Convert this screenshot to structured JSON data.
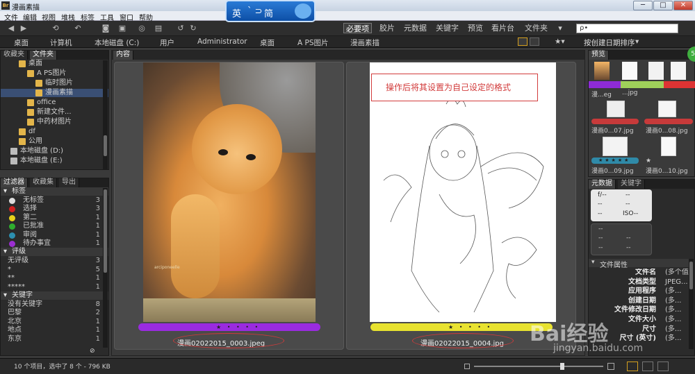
{
  "window": {
    "title": "漫画素描",
    "logo": "Br",
    "min": "─",
    "max": "□",
    "close": "✕"
  },
  "ime": {
    "label_a": "英",
    "label_b": "ˋ ⊃",
    "label_c": "简"
  },
  "menu": [
    "文件",
    "编辑",
    "视图",
    "堆栈",
    "标签",
    "工具",
    "窗口",
    "帮助"
  ],
  "workspaces": [
    "必要项",
    "胶片",
    "元数据",
    "关键字",
    "预览",
    "看片台",
    "文件夹"
  ],
  "search": {
    "placeholder": "ρ•"
  },
  "sort": {
    "label": "按创建日期排序"
  },
  "path": [
    "桌面",
    "计算机",
    "本地磁盘 (C:)",
    "用户",
    "Administrator",
    "桌面",
    "A PS图片",
    "漫画素描"
  ],
  "left_top": {
    "tabs": [
      "收藏夹",
      "文件夹"
    ],
    "items": [
      {
        "label": "桌面",
        "indent": 1
      },
      {
        "label": "A PS图片",
        "indent": 2
      },
      {
        "label": "临时图片",
        "indent": 3
      },
      {
        "label": "漫画素描",
        "indent": 3,
        "selected": true
      },
      {
        "label": "office",
        "indent": 2
      },
      {
        "label": "新建文件...",
        "indent": 2
      },
      {
        "label": "中药材图片",
        "indent": 2
      },
      {
        "label": "df",
        "indent": 1
      },
      {
        "label": "公用",
        "indent": 1
      },
      {
        "label": "本地磁盘 (D:)",
        "indent": 0
      },
      {
        "label": "本地磁盘 (E:)",
        "indent": 0
      }
    ]
  },
  "filter": {
    "tabs": [
      "过滤器",
      "收藏集",
      "导出"
    ],
    "labels_header": "标签",
    "labels": [
      {
        "name": "无标签",
        "count": "3",
        "color": "#dddddd"
      },
      {
        "name": "选择",
        "count": "3",
        "color": "#d22020"
      },
      {
        "name": "第二",
        "count": "1",
        "color": "#e8d21a"
      },
      {
        "name": "已批准",
        "count": "1",
        "color": "#2fae2f"
      },
      {
        "name": "审阅",
        "count": "1",
        "color": "#2c8fb0"
      },
      {
        "name": "待办事宜",
        "count": "1",
        "color": "#9b2ed0"
      }
    ],
    "rating_header": "评级",
    "ratings": [
      {
        "name": "无评级",
        "count": "3"
      },
      {
        "name": "*",
        "count": "5"
      },
      {
        "name": "**",
        "count": "1"
      },
      {
        "name": "*****",
        "count": "1"
      }
    ],
    "keyword_header": "关键字",
    "keywords": [
      {
        "name": "没有关键字",
        "count": "8"
      },
      {
        "name": "巴黎",
        "count": "2"
      },
      {
        "name": "北京",
        "count": "1"
      },
      {
        "name": "地点",
        "count": "1"
      },
      {
        "name": "东京",
        "count": "1"
      }
    ]
  },
  "content": {
    "tab": "内容",
    "items": [
      {
        "filename": "漫画02022015_0003.jpeg",
        "stars": "★ • • • •",
        "label_color": "#9a2be0"
      },
      {
        "filename": "漫画02022015_0004.jpg",
        "stars": "★ • • • •",
        "label_color": "#e8e230"
      }
    ],
    "annotation": "操作后将其设置为自己设定的格式",
    "cat_watermark": "arciponeelle"
  },
  "preview": {
    "tab": "预览",
    "thumbs": [
      {
        "caption": "漫...eg",
        "stars": "★ • • •"
      },
      {
        "caption": "...jpg",
        "stars": "★"
      },
      {
        "caption": "漫画0...07.jpg",
        "stars": "• • • • •"
      },
      {
        "caption": "漫画0...08.jpg",
        "stars": "• • • •"
      },
      {
        "caption": "漫画0...09.jpg",
        "stars": "★★★★★"
      },
      {
        "caption": "漫画0...10.jpg",
        "stars": "★"
      }
    ],
    "badge": "57"
  },
  "metadata": {
    "tabs": [
      "元数据",
      "关键字"
    ],
    "cam1": [
      "f/--",
      "--",
      "--",
      "--",
      "--",
      "ISO--"
    ],
    "cam2": [
      "--",
      "--",
      "--",
      "--",
      "--"
    ],
    "file_props_header": "文件属性",
    "props": [
      {
        "k": "文件名",
        "v": "(多个值)"
      },
      {
        "k": "文档类型",
        "v": "JPEG..."
      },
      {
        "k": "应用程序",
        "v": "(多..."
      },
      {
        "k": "创建日期",
        "v": "(多..."
      },
      {
        "k": "文件修改日期",
        "v": "(多..."
      },
      {
        "k": "文件大小",
        "v": "(多..."
      },
      {
        "k": "尺寸",
        "v": "(多..."
      },
      {
        "k": "尺寸 (英寸)",
        "v": "(多..."
      }
    ]
  },
  "status": {
    "text": "10 个项目，选中了 8 个 - 796 KB"
  },
  "watermark": {
    "brand": "Bai经验",
    "url": "jingyan.baidu.com"
  }
}
